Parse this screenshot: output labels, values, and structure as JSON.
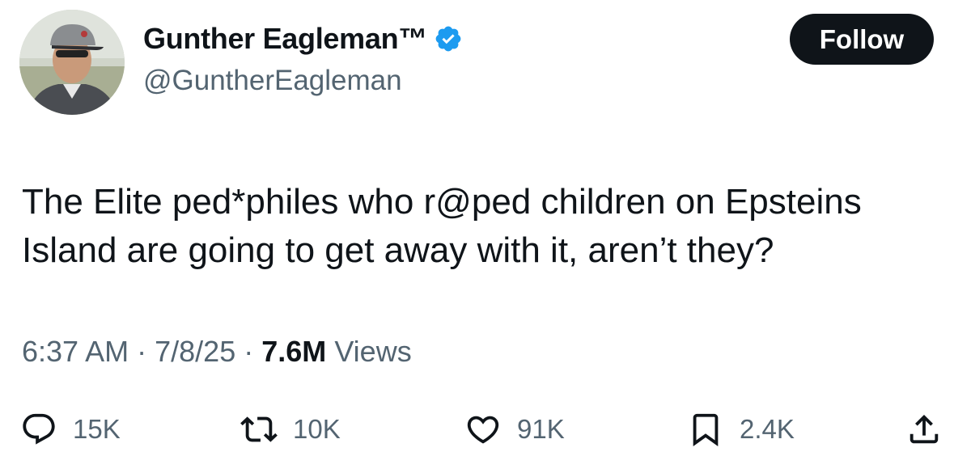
{
  "author": {
    "display_name": "Gunther Eagleman™",
    "handle": "@GuntherEagleman",
    "verified": true,
    "verified_color": "#1d9bf0"
  },
  "follow_button": {
    "label": "Follow"
  },
  "tweet": {
    "text": "The Elite ped*philes who r@ped children on Epsteins\nIsland are going to get away with it,  aren’t they?",
    "time": "6:37 AM",
    "date": "7/8/25",
    "separator": "·",
    "views_count": "7.6M",
    "views_label": "Views"
  },
  "actions": {
    "reply": {
      "icon": "reply-icon",
      "count": "15K"
    },
    "repost": {
      "icon": "repost-icon",
      "count": "10K"
    },
    "like": {
      "icon": "heart-icon",
      "count": "91K"
    },
    "bookmark": {
      "icon": "bookmark-icon",
      "count": "2.4K"
    },
    "share": {
      "icon": "share-icon"
    }
  },
  "colors": {
    "text_primary": "#0f1419",
    "text_secondary": "#536471",
    "button_bg": "#0f1419",
    "button_text": "#ffffff"
  }
}
